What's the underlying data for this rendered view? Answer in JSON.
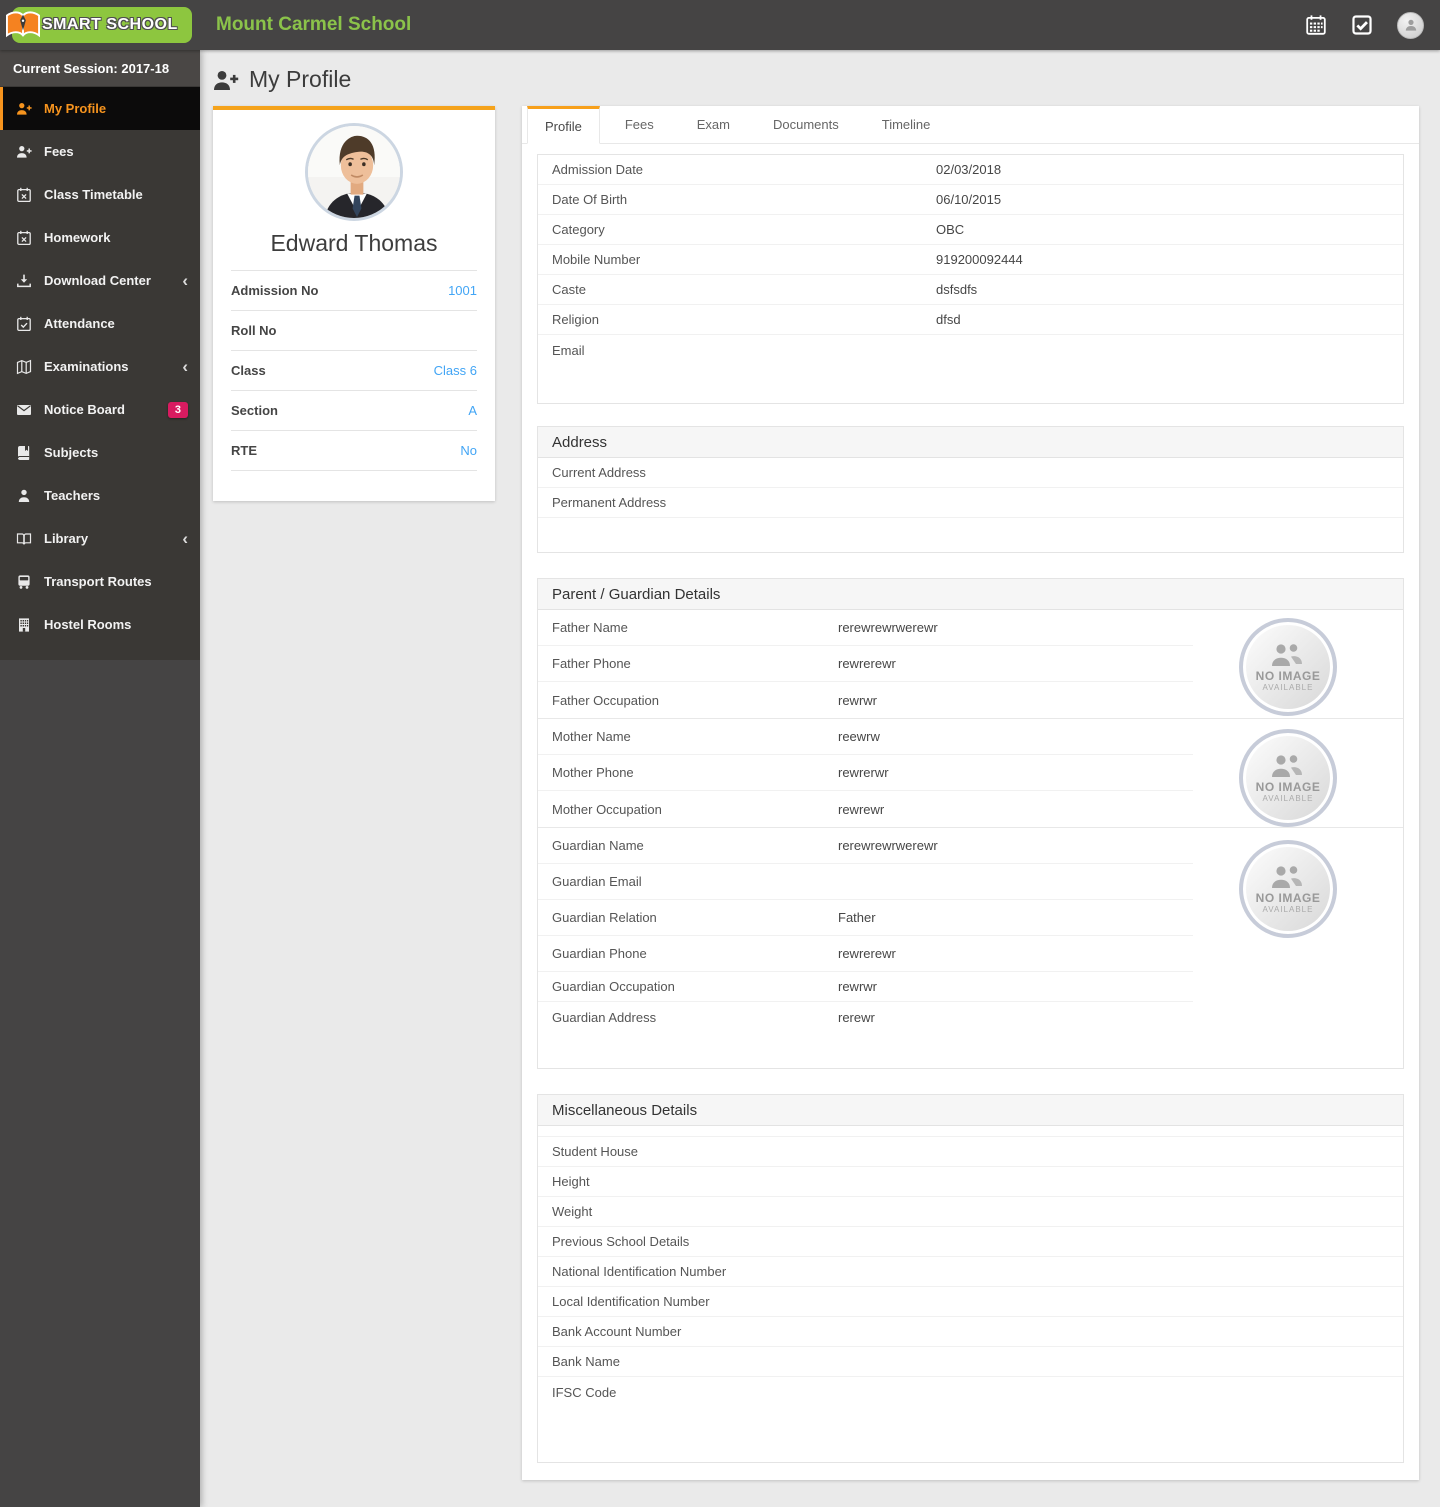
{
  "header": {
    "logo_text": "SMART SCHOOL",
    "school_name": "Mount Carmel School",
    "icons": [
      "calendar-icon",
      "tasks-icon",
      "user-avatar"
    ]
  },
  "sidebar": {
    "session": "Current Session: 2017-18",
    "items": [
      {
        "label": "My Profile",
        "icon": "user-plus-icon",
        "active": true
      },
      {
        "label": "Fees",
        "icon": "user-plus-icon"
      },
      {
        "label": "Class Timetable",
        "icon": "calendar-x-icon"
      },
      {
        "label": "Homework",
        "icon": "calendar-x-icon"
      },
      {
        "label": "Download Center",
        "icon": "download-icon",
        "chevron": true
      },
      {
        "label": "Attendance",
        "icon": "calendar-check-icon"
      },
      {
        "label": "Examinations",
        "icon": "map-icon",
        "chevron": true
      },
      {
        "label": "Notice Board",
        "icon": "envelope-icon",
        "badge": "3"
      },
      {
        "label": "Subjects",
        "icon": "book-icon"
      },
      {
        "label": "Teachers",
        "icon": "person-icon"
      },
      {
        "label": "Library",
        "icon": "open-book-icon",
        "chevron": true
      },
      {
        "label": "Transport Routes",
        "icon": "bus-icon"
      },
      {
        "label": "Hostel Rooms",
        "icon": "building-icon"
      }
    ]
  },
  "page": {
    "title": "My Profile"
  },
  "student": {
    "name": "Edward Thomas",
    "fields": [
      {
        "label": "Admission No",
        "value": "1001"
      },
      {
        "label": "Roll No",
        "value": ""
      },
      {
        "label": "Class",
        "value": "Class 6"
      },
      {
        "label": "Section",
        "value": "A"
      },
      {
        "label": "RTE",
        "value": "No"
      }
    ]
  },
  "tabs": {
    "active": "Profile",
    "items": [
      {
        "label": "Profile"
      },
      {
        "label": "Fees"
      },
      {
        "label": "Exam"
      },
      {
        "label": "Documents"
      },
      {
        "label": "Timeline"
      }
    ]
  },
  "profile": {
    "rows": [
      {
        "label": "Admission Date",
        "value": "02/03/2018"
      },
      {
        "label": "Date Of Birth",
        "value": "06/10/2015"
      },
      {
        "label": "Category",
        "value": "OBC"
      },
      {
        "label": "Mobile Number",
        "value": "919200092444"
      },
      {
        "label": "Caste",
        "value": "dsfsdfs"
      },
      {
        "label": "Religion",
        "value": "dfsd"
      },
      {
        "label": "Email",
        "value": ""
      }
    ]
  },
  "address": {
    "heading": "Address",
    "rows": [
      {
        "label": "Current Address",
        "value": ""
      },
      {
        "label": "Permanent Address",
        "value": ""
      }
    ]
  },
  "guardian": {
    "heading": "Parent / Guardian Details",
    "father": [
      {
        "label": "Father Name",
        "value": "rerewrewrwerewr"
      },
      {
        "label": "Father Phone",
        "value": "rewrerewr"
      },
      {
        "label": "Father Occupation",
        "value": "rewrwr"
      }
    ],
    "mother": [
      {
        "label": "Mother Name",
        "value": "reewrw"
      },
      {
        "label": "Mother Phone",
        "value": "rewrerwr"
      },
      {
        "label": "Mother Occupation",
        "value": "rewrewr"
      }
    ],
    "guardian": [
      {
        "label": "Guardian Name",
        "value": "rerewrewrwerewr"
      },
      {
        "label": "Guardian Email",
        "value": ""
      },
      {
        "label": "Guardian Relation",
        "value": "Father"
      },
      {
        "label": "Guardian Phone",
        "value": "rewrerewr"
      },
      {
        "label": "Guardian Occupation",
        "value": "rewrwr"
      },
      {
        "label": "Guardian Address",
        "value": "rerewr"
      }
    ],
    "no_image": {
      "line1": "NO IMAGE",
      "line2": "AVAILABLE"
    }
  },
  "misc": {
    "heading": "Miscellaneous Details",
    "rows": [
      {
        "label": "Student House",
        "value": ""
      },
      {
        "label": "Height",
        "value": ""
      },
      {
        "label": "Weight",
        "value": ""
      },
      {
        "label": "Previous School Details",
        "value": ""
      },
      {
        "label": "National Identification Number",
        "value": ""
      },
      {
        "label": "Local Identification Number",
        "value": ""
      },
      {
        "label": "Bank Account Number",
        "value": ""
      },
      {
        "label": "Bank Name",
        "value": ""
      },
      {
        "label": "IFSC Code",
        "value": ""
      }
    ]
  },
  "colors": {
    "accent_orange": "#f7941e",
    "brand_green": "#8bc34a",
    "logo_green": "#8dc63f",
    "link_blue": "#42a5f5",
    "badge_pink": "#d81b60",
    "sidebar_dark": "#3a3835",
    "header_dark": "#454444"
  }
}
